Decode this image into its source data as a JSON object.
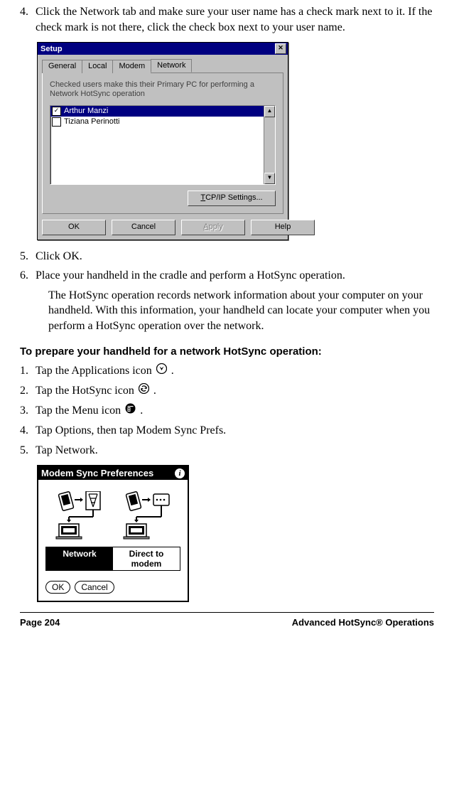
{
  "steps_a": [
    {
      "num": "4.",
      "text": "Click the Network tab and make sure your user name has a check mark next to it. If the check mark is not there, click the check box next to your user name."
    }
  ],
  "setup_dialog": {
    "title": "Setup",
    "tabs": [
      "General",
      "Local",
      "Modem",
      "Network"
    ],
    "desc": "Checked users make this their Primary PC for performing a Network HotSync operation",
    "users": [
      {
        "name": "Arthur Manzi",
        "checked": true,
        "selected": true
      },
      {
        "name": "Tiziana Perinotti",
        "checked": false,
        "selected": false
      }
    ],
    "tcp_button": "TCP/IP Settings...",
    "buttons": {
      "ok": "OK",
      "cancel": "Cancel",
      "apply": "Apply",
      "help": "Help"
    }
  },
  "steps_b": [
    {
      "num": "5.",
      "text": "Click OK."
    },
    {
      "num": "6.",
      "text": "Place your handheld in the cradle and perform a HotSync operation."
    }
  ],
  "step6_detail": "The HotSync operation records network information about your computer on your handheld. With this information, your handheld can locate your computer when you perform a HotSync operation over the network.",
  "subhead": "To prepare your handheld for a network HotSync operation:",
  "steps_c": [
    {
      "num": "1.",
      "text_a": "Tap the Applications icon ",
      "text_b": "."
    },
    {
      "num": "2.",
      "text_a": "Tap the HotSync icon ",
      "text_b": "."
    },
    {
      "num": "3.",
      "text_a": "Tap the Menu icon ",
      "text_b": "."
    },
    {
      "num": "4.",
      "text": "Tap Options, then tap Modem Sync Prefs."
    },
    {
      "num": "5.",
      "text": "Tap Network."
    }
  ],
  "palm": {
    "title": "Modem Sync Preferences",
    "options": [
      "Network",
      "Direct to modem"
    ],
    "selected": "Network",
    "ok": "OK",
    "cancel": "Cancel"
  },
  "footer": {
    "page": "Page 204",
    "section": "Advanced HotSync® Operations"
  }
}
